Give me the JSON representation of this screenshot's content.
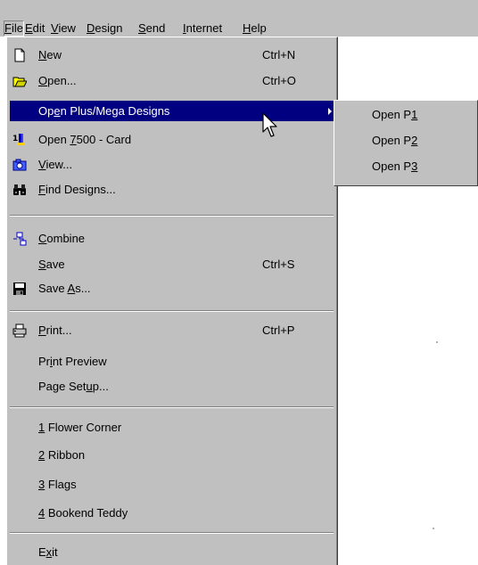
{
  "menubar": {
    "items": [
      {
        "pre": "",
        "key": "F",
        "post": "ile"
      },
      {
        "pre": "",
        "key": "E",
        "post": "dit"
      },
      {
        "pre": "",
        "key": "V",
        "post": "iew"
      },
      {
        "pre": "",
        "key": "D",
        "post": "esign"
      },
      {
        "pre": "",
        "key": "S",
        "post": "end"
      },
      {
        "pre": "",
        "key": "I",
        "post": "nternet"
      },
      {
        "pre": "",
        "key": "H",
        "post": "elp"
      }
    ]
  },
  "file_menu": {
    "new": {
      "pre": "",
      "key": "N",
      "post": "ew",
      "shortcut": "Ctrl+N",
      "icon": "new-document-icon"
    },
    "open": {
      "pre": "",
      "key": "O",
      "post": "pen...",
      "shortcut": "Ctrl+O",
      "icon": "open-folder-icon"
    },
    "open_plus": {
      "pre": "Op",
      "key": "e",
      "post": "n Plus/Mega Designs",
      "icon": "submenu-arrow-icon"
    },
    "open_7500": {
      "pre": "Open ",
      "key": "7",
      "post": "500 - Card",
      "icon": "card-7500-icon"
    },
    "view": {
      "pre": "",
      "key": "V",
      "post": "iew...",
      "icon": "camera-icon"
    },
    "find": {
      "pre": "",
      "key": "F",
      "post": "ind Designs...",
      "icon": "binoculars-icon"
    },
    "combine": {
      "pre": "",
      "key": "C",
      "post": "ombine",
      "icon": "combine-icon"
    },
    "save": {
      "pre": "",
      "key": "S",
      "post": "ave",
      "shortcut": "Ctrl+S"
    },
    "save_as": {
      "pre": "Save ",
      "key": "A",
      "post": "s...",
      "icon": "floppy-disk-icon"
    },
    "print": {
      "pre": "",
      "key": "P",
      "post": "rint...",
      "shortcut": "Ctrl+P",
      "icon": "printer-icon"
    },
    "print_preview": {
      "pre": "Pr",
      "key": "i",
      "post": "nt Preview"
    },
    "page_setup": {
      "pre": "Page Set",
      "key": "u",
      "post": "p..."
    },
    "recent": [
      {
        "pre": "",
        "key": "1",
        "post": " Flower Corner"
      },
      {
        "pre": "",
        "key": "2",
        "post": " Ribbon"
      },
      {
        "pre": "",
        "key": "3",
        "post": " Flags"
      },
      {
        "pre": "",
        "key": "4",
        "post": " Bookend Teddy"
      }
    ],
    "exit": {
      "pre": "E",
      "key": "x",
      "post": "it"
    }
  },
  "submenu": {
    "items": [
      {
        "pre": "Open P",
        "key": "1",
        "post": ""
      },
      {
        "pre": "Open P",
        "key": "2",
        "post": ""
      },
      {
        "pre": "Open P",
        "key": "3",
        "post": ""
      }
    ]
  },
  "colors": {
    "menu_bg": "#c0c0c0",
    "highlight_bg": "#000080",
    "highlight_text": "#ffffff"
  },
  "cursor_icon": "mouse-pointer-icon"
}
